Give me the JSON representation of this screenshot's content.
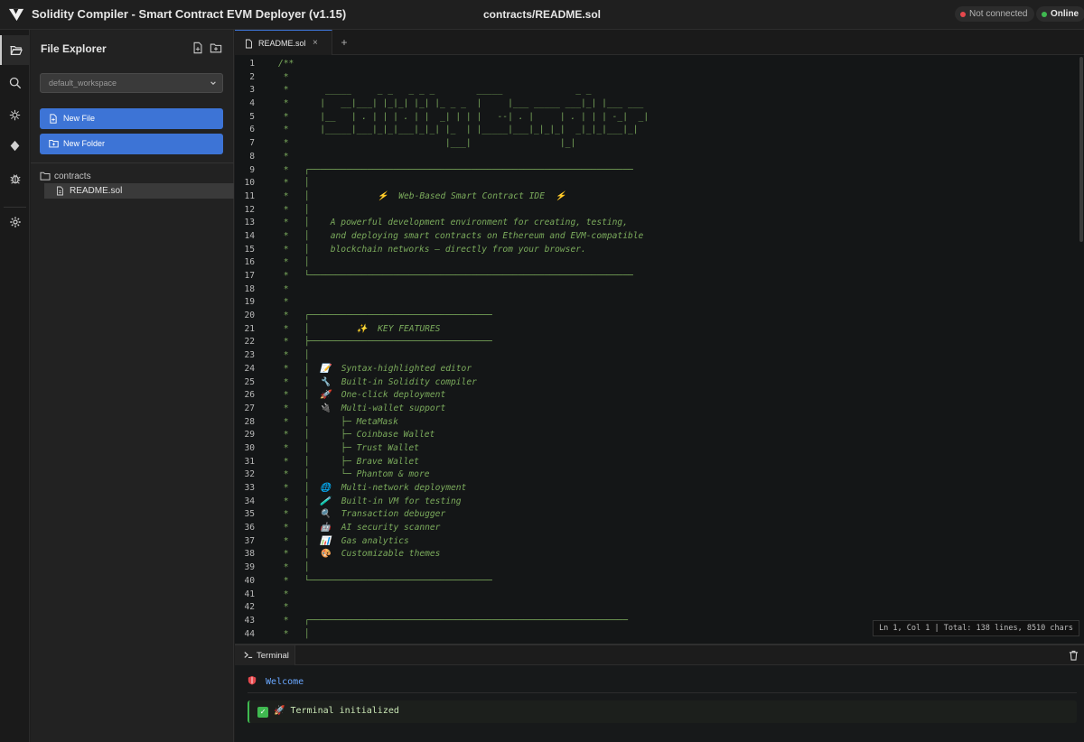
{
  "app": {
    "title": "Solidity Compiler - Smart Contract EVM Deployer (v1.15)",
    "file_path": "contracts/README.sol",
    "status_wallet": "Not connected",
    "status_network": "Online"
  },
  "sidebar": {
    "title": "File Explorer",
    "workspace": "default_workspace",
    "new_file_label": "New File",
    "new_folder_label": "New Folder",
    "tree": {
      "folder": "contracts",
      "file": "README.sol"
    }
  },
  "tabs": [
    {
      "label": "README.sol",
      "close": "×"
    }
  ],
  "tab_add": "+",
  "editor": {
    "line_numbers": [
      "1",
      "2",
      "3",
      "4",
      "5",
      "6",
      "7",
      "8",
      "9",
      "10",
      "11",
      "12",
      "13",
      "14",
      "15",
      "16",
      "17",
      "18",
      "19",
      "20",
      "21",
      "22",
      "23",
      "24",
      "25",
      "26",
      "27",
      "28",
      "29",
      "30",
      "31",
      "32",
      "33",
      "34",
      "35",
      "36",
      "37",
      "38",
      "39",
      "40",
      "41",
      "42",
      "43",
      "44"
    ],
    "lines": [
      "/**",
      " *",
      " *       _____     _ _   _ _ _        _____              _ _",
      " *      |   __|___| |_|_| |_| |_ _ _  |     |___ _____ ___|_| |___ ___",
      " *      |__   | . | | | . | |  _| | | |   --| . |     | . | | | -_|  _|",
      " *      |_____|___|_|_|___|_|_| |_  | |_____|___|_|_|_|  _|_|_|___|_|",
      " *                              |___|                 |_|",
      " *",
      " *   ┌──────────────────────────────────────────────────────────────",
      " *   │",
      " *   │             ⚡  Web-Based Smart Contract IDE  ⚡",
      " *   │",
      " *   │    A powerful development environment for creating, testing,",
      " *   │    and deploying smart contracts on Ethereum and EVM-compatible",
      " *   │    blockchain networks — directly from your browser.",
      " *   │",
      " *   └──────────────────────────────────────────────────────────────",
      " *",
      " *",
      " *   ┌───────────────────────────────────",
      " *   │         ✨  KEY FEATURES",
      " *   ├───────────────────────────────────",
      " *   │",
      " *   │  📝  Syntax-highlighted editor",
      " *   │  🔧  Built-in Solidity compiler",
      " *   │  🚀  One-click deployment",
      " *   │  🔌  Multi-wallet support",
      " *   │      ├─ MetaMask",
      " *   │      ├─ Coinbase Wallet",
      " *   │      ├─ Trust Wallet",
      " *   │      ├─ Brave Wallet",
      " *   │      └─ Phantom & more",
      " *   │  🌐  Multi-network deployment",
      " *   │  🧪  Built-in VM for testing",
      " *   │  🔍  Transaction debugger",
      " *   │  🤖  AI security scanner",
      " *   │  📊  Gas analytics",
      " *   │  🎨  Customizable themes",
      " *   │",
      " *   └───────────────────────────────────",
      " *",
      " *",
      " *   ┌─────────────────────────────────────────────────────────────",
      " *   │"
    ],
    "status": "Ln 1, Col 1 | Total: 138 lines, 8510 chars"
  },
  "terminal": {
    "tab_label": "Terminal",
    "welcome": "Welcome",
    "line_text": "🚀 Terminal initialized"
  },
  "colors": {
    "accent": "#3d74d6",
    "comment": "#7bab5c",
    "success": "#3fb950",
    "danger": "#e5484d"
  }
}
